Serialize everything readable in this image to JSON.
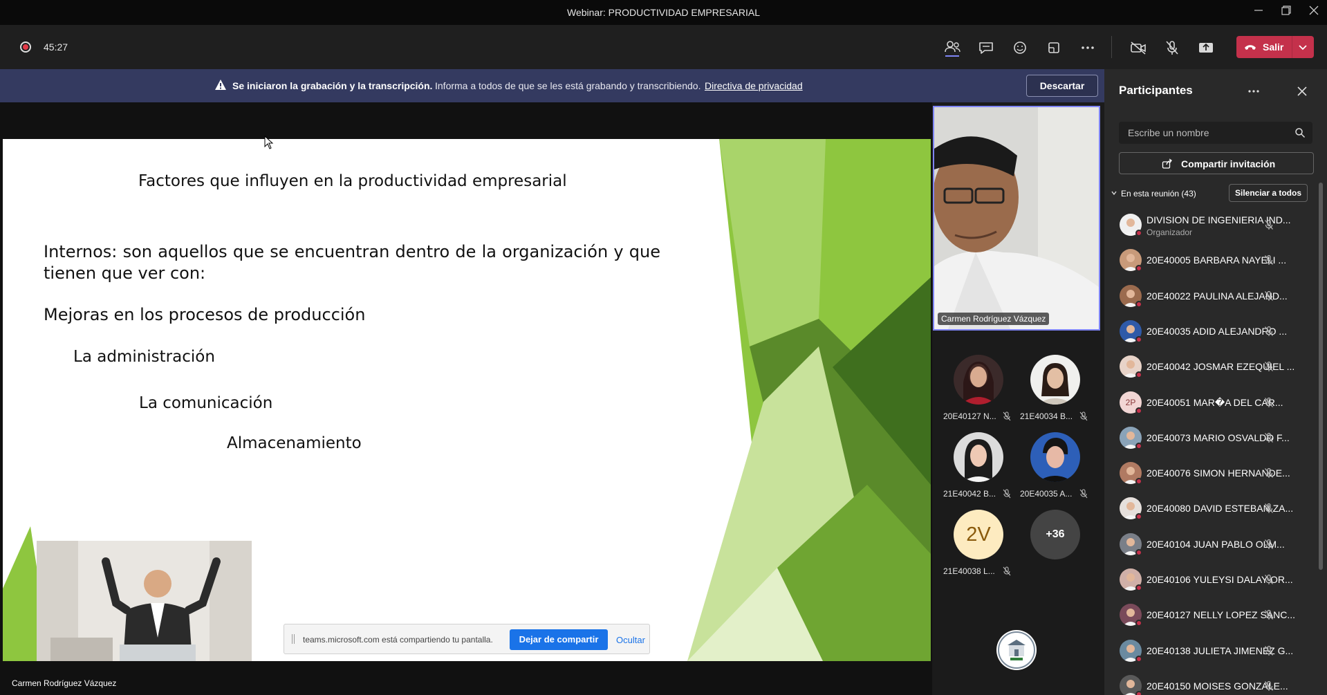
{
  "window": {
    "title": "Webinar: PRODUCTIVIDAD EMPRESARIAL"
  },
  "toolbar": {
    "timer": "45:27",
    "leave_label": "Salir",
    "accent": "#c4314b",
    "icons": [
      "people-icon",
      "chat-icon",
      "reactions-icon",
      "rooms-icon",
      "more-icon",
      "camera-off-icon",
      "mic-off-icon",
      "share-icon"
    ]
  },
  "banner": {
    "bold_text": "Se iniciaron la grabación y la transcripción.",
    "info_text": "Informa a todos de que se les está grabando y transcribiendo.",
    "privacy_link": "Directiva de privacidad",
    "dismiss_label": "Descartar",
    "bg_color": "#343a60"
  },
  "slide": {
    "title": "Factores que influyen en la productividad empresarial",
    "internal": "Internos: son aquellos que se encuentran dentro de la organización y que tienen que ver con:",
    "items": [
      "Mejoras en los procesos de producción",
      "La administración",
      "La comunicación",
      "Almacenamiento"
    ]
  },
  "share_bar": {
    "message": "teams.microsoft.com está compartiendo tu pantalla.",
    "stop_label": "Dejar de compartir",
    "hide_label": "Ocultar"
  },
  "presenter": {
    "name": "Carmen Rodríguez Vázquez"
  },
  "video": {
    "main_name": "Carmen Rodríguez Vázquez",
    "tiles": [
      {
        "name": "20E40127 N..."
      },
      {
        "name": "21E40034 B..."
      },
      {
        "name": "21E40042 B..."
      },
      {
        "name": "20E40035 A..."
      },
      {
        "name": "21E40038 L...",
        "initials": "2V"
      }
    ],
    "overflow": "+36"
  },
  "panel": {
    "title": "Participantes",
    "search_placeholder": "Escribe un nombre",
    "invite_label": "Compartir invitación",
    "section_label": "En esta reunión (43)",
    "mute_all_label": "Silenciar a todos",
    "participants": [
      {
        "name": "DIVISION DE INGENIERIA IND...",
        "role": "Organizador"
      },
      {
        "name": "20E40005 BARBARA NAYELI ..."
      },
      {
        "name": "20E40022 PAULINA ALEJAND..."
      },
      {
        "name": "20E40035 ADID ALEJANDRO ..."
      },
      {
        "name": "20E40042 JOSMAR EZEQUIEL ..."
      },
      {
        "name": "20E40051 MAR�A DEL CAR...",
        "initials": "2P"
      },
      {
        "name": "20E40073 MARIO OSVALDO F..."
      },
      {
        "name": "20E40076 SIMON HERNANDE..."
      },
      {
        "name": "20E40080 DAVID ESTEBAN ZA..."
      },
      {
        "name": "20E40104 JUAN PABLO OLM..."
      },
      {
        "name": "20E40106 YULEYSI DALAY OR..."
      },
      {
        "name": "20E40127 NELLY LOPEZ SANC..."
      },
      {
        "name": "20E40138 JULIETA JIMENEZ G..."
      },
      {
        "name": "20E40150 MOISES GONZALE..."
      }
    ]
  }
}
